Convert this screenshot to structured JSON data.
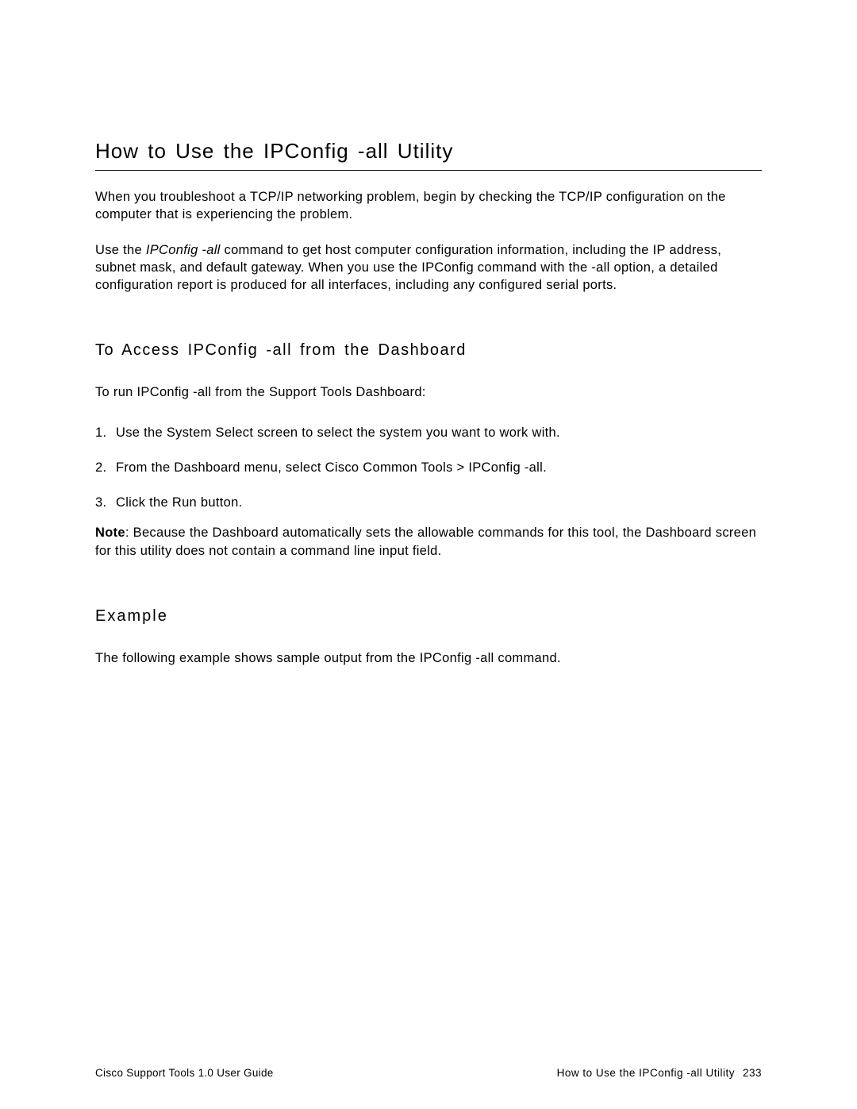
{
  "title": "How to Use the IPConfig -all Utility",
  "intro": {
    "p1": "When you troubleshoot a TCP/IP networking problem, begin by checking the TCP/IP configuration on the computer that is experiencing the problem.",
    "p2_prefix": "Use the ",
    "p2_italic": "IPConfig -all",
    "p2_suffix": " command to get host computer configuration information, including the IP address, subnet mask, and default gateway. When you use the IPConfig command with the -all option, a detailed configuration report is produced for all interfaces, including any configured serial ports."
  },
  "section1": {
    "heading": "To Access IPConfig -all from the Dashboard",
    "intro": "To run IPConfig -all from the Support Tools Dashboard:",
    "steps": [
      "Use the System Select screen to select the system you want to work with.",
      "From the Dashboard menu, select Cisco Common Tools > IPConfig -all.",
      "Click the Run button."
    ],
    "note_label": "Note",
    "note_text": ": Because the Dashboard automatically sets the allowable commands for this tool, the Dashboard screen for this utility does not contain a command line input field."
  },
  "section2": {
    "heading": "Example",
    "body": "The following example shows sample output from the IPConfig -all command."
  },
  "footer": {
    "left": "Cisco Support Tools 1.0 User Guide",
    "right_title": "How to Use the IPConfig -all Utility",
    "page_number": "233"
  }
}
